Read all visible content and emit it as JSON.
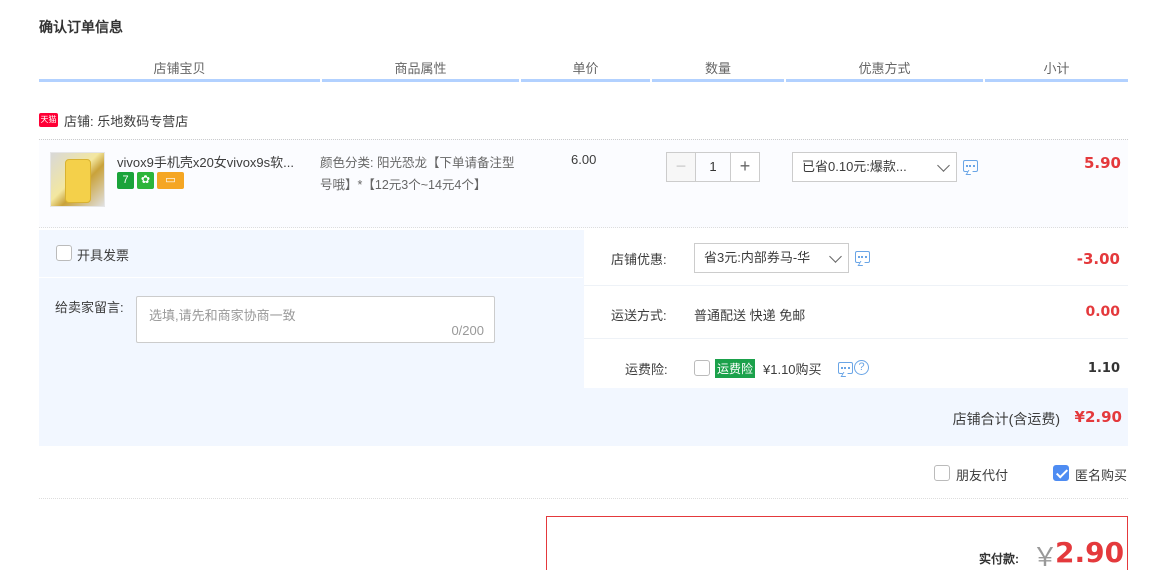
{
  "page": {
    "title": "确认订单信息"
  },
  "columns": [
    "店铺宝贝",
    "商品属性",
    "单价",
    "数量",
    "优惠方式",
    "小计"
  ],
  "shop": {
    "badge": "天猫",
    "label": "店铺: 乐地数码专营店"
  },
  "item": {
    "name": "vivox9手机壳x20女vivox9s软...",
    "badges": [
      {
        "text": "7",
        "color": "#1aa33a"
      },
      {
        "text": "✿",
        "color": "#2db53a"
      },
      {
        "text": "▭",
        "color": "#f5a623"
      }
    ],
    "attr": "颜色分类: 阳光恐龙【下单请备注型号哦】*【12元3个~14元4个】",
    "unit_price": "6.00",
    "quantity": "1",
    "minus": "−",
    "plus": "+",
    "discount": "已省0.10元:爆款...",
    "subtotal": "5.90"
  },
  "invoice": {
    "label": "开具发票",
    "checked": false
  },
  "message": {
    "label": "给卖家留言:",
    "placeholder": "选填,请先和商家协商一致",
    "counter": "0/200"
  },
  "shop_discount": {
    "label": "店铺优惠:",
    "value": "省3元:内部券马-华",
    "amount": "-3.00"
  },
  "shipping": {
    "label": "运送方式:",
    "value": "普通配送 快递 免邮",
    "amount": "0.00"
  },
  "insurance": {
    "label": "运费险:",
    "badge": "运费险",
    "price": "¥1.10购买",
    "help": "?",
    "amount": "1.10",
    "checked": false
  },
  "shop_total": {
    "label": "店铺合计(含运费)",
    "amount": "¥2.90"
  },
  "options": {
    "friend_pay": "朋友代付",
    "friend_checked": false,
    "anonymous": "匿名购买",
    "anonymous_checked": true
  },
  "pay": {
    "label": "实付款:",
    "currency": "￥",
    "amount": "2.90"
  }
}
